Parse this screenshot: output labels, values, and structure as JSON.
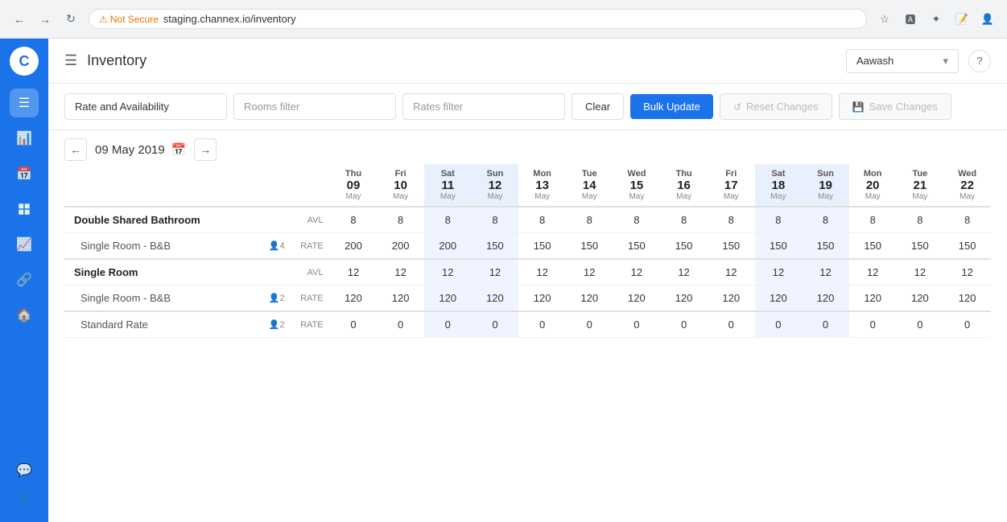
{
  "browser": {
    "not_secure_label": "Not Secure",
    "address": "staging.channex.io/inventory",
    "nav_back": "←",
    "nav_forward": "→",
    "nav_reload": "↻"
  },
  "sidebar": {
    "logo": "C",
    "icons": [
      "☰",
      "📊",
      "📅",
      "📋",
      "📦",
      "📈",
      "🔗",
      "🏠",
      "💬",
      "👤"
    ]
  },
  "header": {
    "menu_icon": "☰",
    "title": "Inventory",
    "property": "Aawash",
    "help": "?"
  },
  "toolbar": {
    "rate_avail_label": "Rate and Availability",
    "rate_avail_placeholder": "Rate and Availability",
    "rooms_filter_placeholder": "Rooms filter",
    "rates_filter_placeholder": "Rates filter",
    "clear_label": "Clear",
    "bulk_update_label": "Bulk Update",
    "reset_label": "Reset Changes",
    "save_label": "Save Changes"
  },
  "calendar": {
    "current_date": "09 May 2019",
    "nav_prev": "←",
    "nav_next": "→",
    "columns": [
      {
        "day": "Thu",
        "num": "09",
        "month": "May",
        "weekend": false
      },
      {
        "day": "Fri",
        "num": "10",
        "month": "May",
        "weekend": false
      },
      {
        "day": "Sat",
        "num": "11",
        "month": "May",
        "weekend": true
      },
      {
        "day": "Sun",
        "num": "12",
        "month": "May",
        "weekend": true
      },
      {
        "day": "Mon",
        "num": "13",
        "month": "May",
        "weekend": false
      },
      {
        "day": "Tue",
        "num": "14",
        "month": "May",
        "weekend": false
      },
      {
        "day": "Wed",
        "num": "15",
        "month": "May",
        "weekend": false
      },
      {
        "day": "Thu",
        "num": "16",
        "month": "May",
        "weekend": false
      },
      {
        "day": "Fri",
        "num": "17",
        "month": "May",
        "weekend": false
      },
      {
        "day": "Sat",
        "num": "18",
        "month": "May",
        "weekend": true
      },
      {
        "day": "Sun",
        "num": "19",
        "month": "May",
        "weekend": true
      },
      {
        "day": "Mon",
        "num": "20",
        "month": "May",
        "weekend": false
      },
      {
        "day": "Tue",
        "num": "21",
        "month": "May",
        "weekend": false
      },
      {
        "day": "Wed",
        "num": "22",
        "month": "May",
        "weekend": false
      }
    ]
  },
  "table": {
    "rows": [
      {
        "id": "double-shared-avl",
        "room_type": "Double Shared Bathroom",
        "label": "AVL",
        "is_group": true,
        "guest_count": null,
        "values": [
          8,
          8,
          8,
          8,
          8,
          8,
          8,
          8,
          8,
          8,
          8,
          8,
          8,
          8
        ]
      },
      {
        "id": "double-shared-bnb",
        "room_type": "",
        "rate_name": "Single Room - B&B",
        "label": "RATE",
        "is_group": false,
        "guest_count": "4",
        "values": [
          200,
          200,
          200,
          150,
          150,
          150,
          150,
          150,
          150,
          150,
          150,
          150,
          150,
          150
        ]
      },
      {
        "id": "single-room-avl",
        "room_type": "Single Room",
        "label": "AVL",
        "is_group": true,
        "guest_count": null,
        "values": [
          12,
          12,
          12,
          12,
          12,
          12,
          12,
          12,
          12,
          12,
          12,
          12,
          12,
          12
        ]
      },
      {
        "id": "single-room-bnb",
        "room_type": "",
        "rate_name": "Single Room - B&B",
        "label": "RATE",
        "is_group": false,
        "guest_count": "2",
        "values": [
          120,
          120,
          120,
          120,
          120,
          120,
          120,
          120,
          120,
          120,
          120,
          120,
          120,
          120
        ]
      },
      {
        "id": "single-room-standard",
        "room_type": "",
        "rate_name": "Standard Rate",
        "label": "RATE",
        "is_group": false,
        "guest_count": "2",
        "values": [
          0,
          0,
          0,
          0,
          0,
          0,
          0,
          0,
          0,
          0,
          0,
          0,
          0,
          0
        ]
      }
    ]
  }
}
